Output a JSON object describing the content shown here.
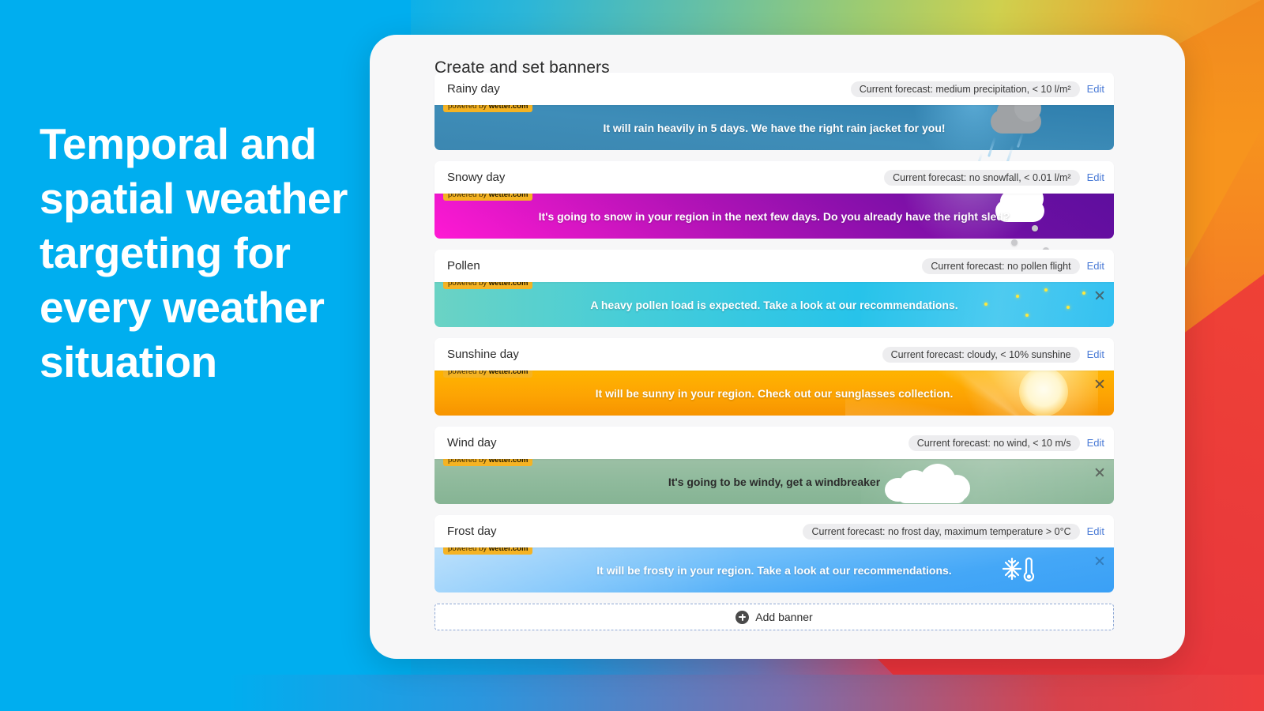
{
  "headline": "Temporal and spatial weather targeting for every weather situation",
  "card": {
    "title": "Create and set banners",
    "edit_label": "Edit",
    "powered_prefix": "powered by ",
    "powered_brand": "wetter.com",
    "add_banner_label": "Add banner",
    "add_icon": "plus-circle-icon"
  },
  "colors": {
    "brand_blue": "#00AEEF",
    "badge_yellow": "#F5B323",
    "edit_link": "#4A7BD6",
    "chip_bg": "#EDEDEF",
    "card_bg": "#F7F7F8"
  },
  "banners": [
    {
      "name": "Rainy day",
      "forecast": "Current forecast: medium precipitation, < 10 l/m²",
      "message": "It will rain heavily in 5 days. We have the right rain jacket for you!",
      "icon": "rain-cloud-icon",
      "closable": false
    },
    {
      "name": "Snowy day",
      "forecast": "Current forecast: no snowfall, < 0.01 l/m²",
      "message": "It's going to snow in your region in the next few days.  Do you already have the right sled?",
      "icon": "snow-cloud-icon",
      "closable": false
    },
    {
      "name": "Pollen",
      "forecast": "Current forecast: no pollen flight",
      "message": "A heavy pollen load is expected. Take a look at our recommendations.",
      "icon": "pollen-icon",
      "closable": true
    },
    {
      "name": "Sunshine day",
      "forecast": "Current forecast: cloudy, < 10% sunshine",
      "message": "It will be sunny in your region. Check out our sunglasses collection.",
      "icon": "sun-icon",
      "closable": true
    },
    {
      "name": "Wind day",
      "forecast": "Current forecast: no wind, < 10 m/s",
      "message": "It's going to be windy, get a windbreaker",
      "icon": "wind-cloud-icon",
      "closable": true
    },
    {
      "name": "Frost day",
      "forecast": "Current forecast: no frost day, maximum temperature > 0°C",
      "message": "It will be frosty in your region. Take a look at our recommendations.",
      "icon": "snowflake-thermometer-icon",
      "closable": true
    }
  ]
}
